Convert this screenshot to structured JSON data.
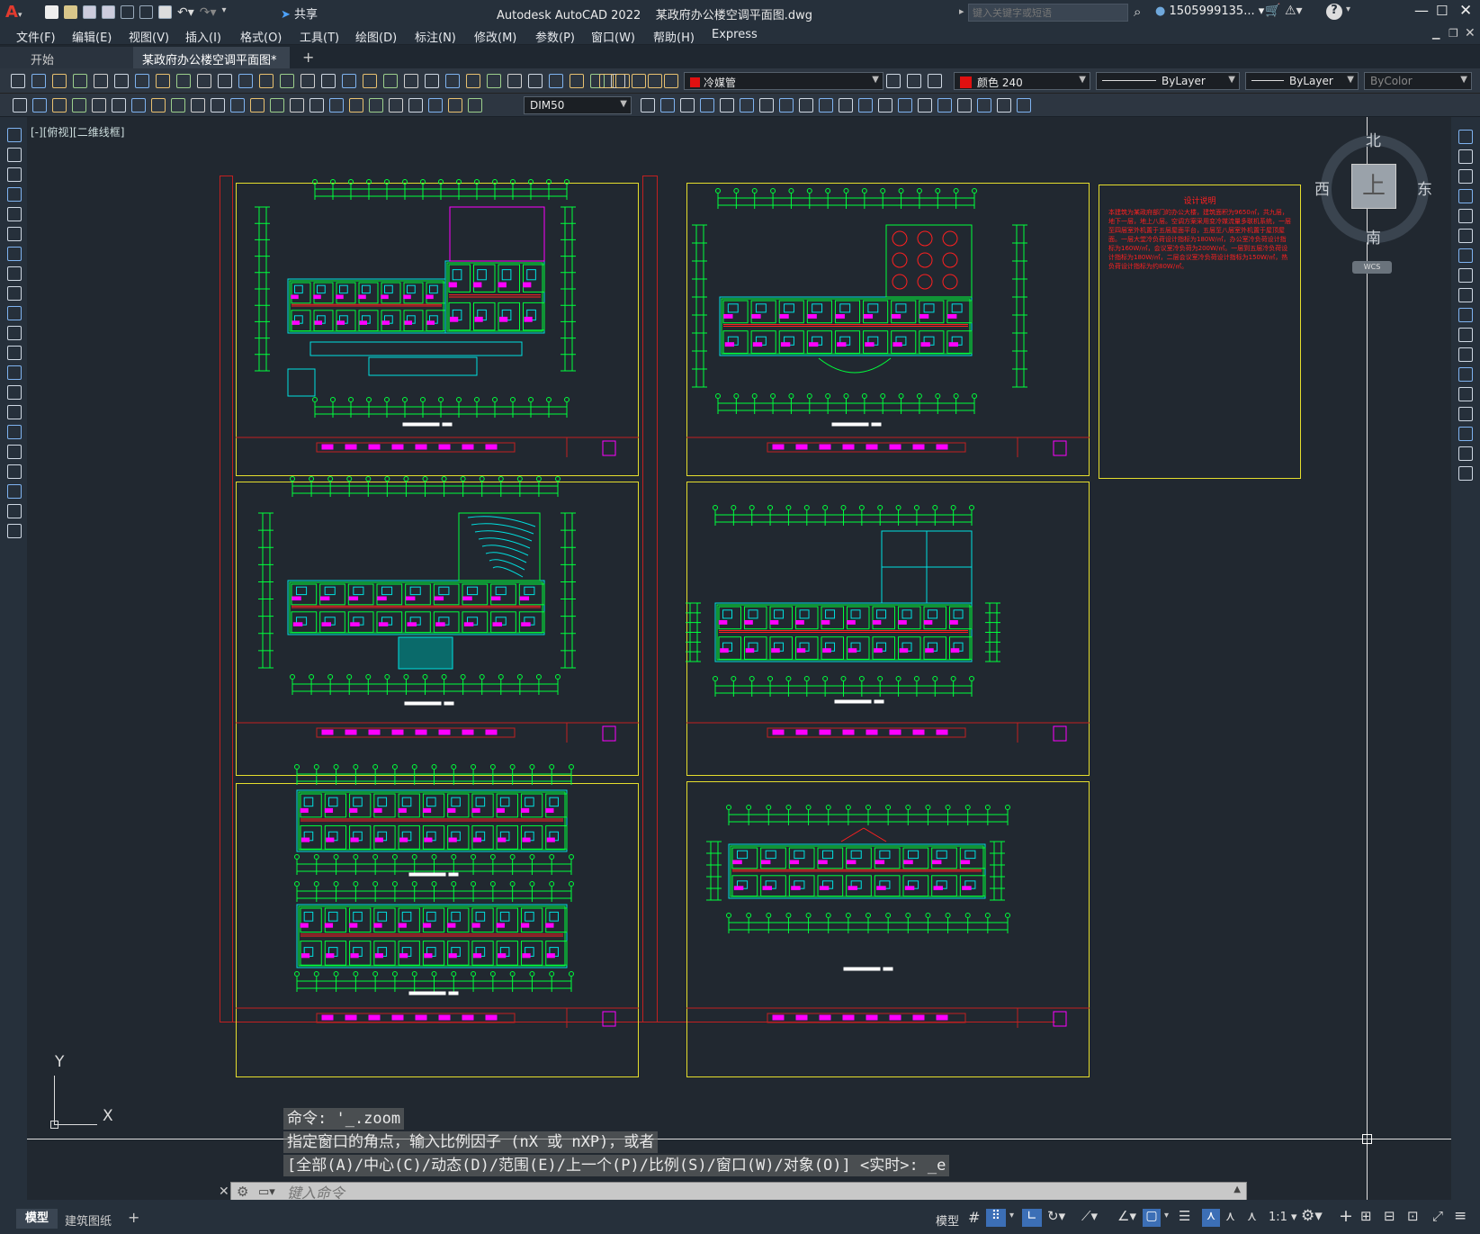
{
  "app": {
    "title": "Autodesk AutoCAD 2022",
    "file": "某政府办公楼空调平面图.dwg",
    "share": "共享",
    "search_placeholder": "键入关键字或短语",
    "user": "1505999135...",
    "help": "?"
  },
  "menu": [
    "文件(F)",
    "编辑(E)",
    "视图(V)",
    "插入(I)",
    "格式(O)",
    "工具(T)",
    "绘图(D)",
    "标注(N)",
    "修改(M)",
    "参数(P)",
    "窗口(W)",
    "帮助(H)",
    "Express"
  ],
  "tabs": {
    "start": "开始",
    "active": "某政府办公楼空调平面图*",
    "add": "+"
  },
  "toolbar": {
    "layer": "冷媒管",
    "color": "颜色 240",
    "linetype": "ByLayer",
    "lineweight": "ByLayer",
    "plotstyle": "ByColor",
    "dimstyle": "DIM50"
  },
  "viewport": {
    "label": "[-][俯视][二维线框]"
  },
  "viewcube": {
    "north": "北",
    "south": "南",
    "east": "东",
    "west": "西",
    "top": "上",
    "wcs": "WCS"
  },
  "notes": {
    "title": "设计说明",
    "body": "本建筑为某政府部门的办公大楼，建筑面积为9650㎡，共九层，地下一层，地上八层。空调方案采用变冷媒流量多联机系统，一层至四层室外机置于五层屋面平台，五层至八层室外机置于屋顶屋面。一层大堂冷负荷设计指标为180W/㎡，办公室冷负荷设计指标为160W/㎡，会议室冷负荷为200W/㎡。一层到五层冷负荷设计指标为180W/㎡，二层会议室冷负荷设计指标为150W/㎡，热负荷设计指标为约80W/㎡。"
  },
  "ucs": {
    "x": "X",
    "y": "Y"
  },
  "command": {
    "line1": "命令: '_.zoom",
    "line2": "指定窗口的角点，输入比例因子 (nX 或 nXP)，或者",
    "line3": "[全部(A)/中心(C)/动态(D)/范围(E)/上一个(P)/比例(S)/窗口(W)/对象(O)] <实时>: _e",
    "placeholder": "键入命令"
  },
  "layout_tabs": {
    "model": "模型",
    "layout1": "建筑图纸",
    "add": "+"
  },
  "status": {
    "model": "模型",
    "scale": "1:1"
  },
  "colors": {
    "accent": "#e6de2d",
    "frame": "#c22020",
    "cad_green": "#00ff3c",
    "cad_cyan": "#00e0e0",
    "cad_magenta": "#ff00ff",
    "cad_red": "#ff2020"
  }
}
